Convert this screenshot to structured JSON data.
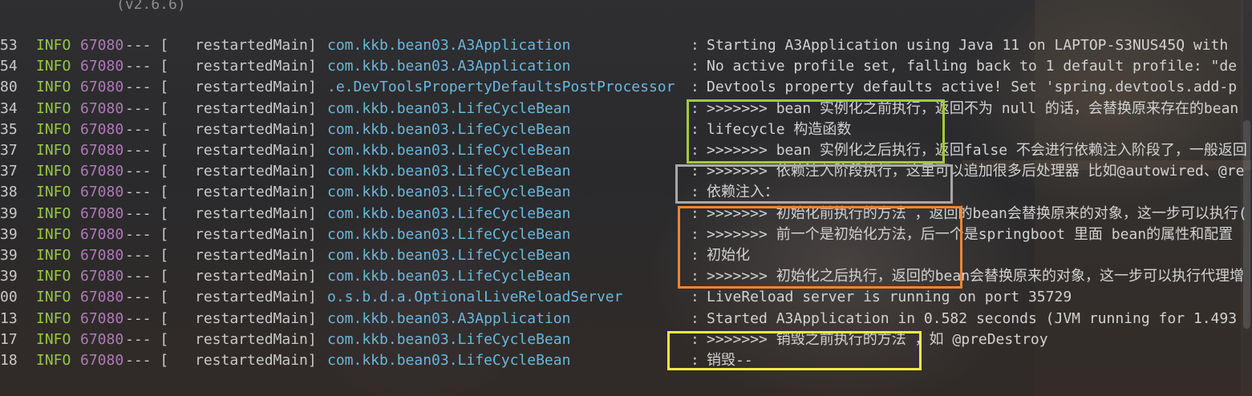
{
  "banner": "(v2.6.6)",
  "highlight_colors": {
    "green": "#a3c93a",
    "gray": "#a8a8a8",
    "orange": "#e8863a",
    "yellow": "#f1ee3a"
  },
  "log_lines": [
    {
      "ms": "53",
      "level": "INFO",
      "pid": "67080",
      "sep": "--- [",
      "thread": "restartedMain]",
      "logger": "com.kkb.bean03.A3Application",
      "colon": ":",
      "message": "Starting A3Application using Java 11 on LAPTOP-S3NUS45Q with"
    },
    {
      "ms": "54",
      "level": "INFO",
      "pid": "67080",
      "sep": "--- [",
      "thread": "restartedMain]",
      "logger": "com.kkb.bean03.A3Application",
      "colon": ":",
      "message": "No active profile set, falling back to 1 default profile: \"de"
    },
    {
      "ms": "80",
      "level": "INFO",
      "pid": "67080",
      "sep": "--- [",
      "thread": "restartedMain]",
      "logger": ".e.DevToolsPropertyDefaultsPostProcessor",
      "colon": ":",
      "message": "Devtools property defaults active! Set 'spring.devtools.add-p"
    },
    {
      "ms": "34",
      "level": "INFO",
      "pid": "67080",
      "sep": "--- [",
      "thread": "restartedMain]",
      "logger": "com.kkb.bean03.LifeCycleBean",
      "colon": ":",
      "message": ">>>>>>> bean 实例化之前执行，返回不为 null 的话，会替换原来存在的bean"
    },
    {
      "ms": "35",
      "level": "INFO",
      "pid": "67080",
      "sep": "--- [",
      "thread": "restartedMain]",
      "logger": "com.kkb.bean03.LifeCycleBean",
      "colon": ":",
      "message": "lifecycle 构造函数"
    },
    {
      "ms": "37",
      "level": "INFO",
      "pid": "67080",
      "sep": "--- [",
      "thread": "restartedMain]",
      "logger": "com.kkb.bean03.LifeCycleBean",
      "colon": ":",
      "message": ">>>>>>> bean 实例化之后执行，返回false 不会进行依赖注入阶段了，一般返回"
    },
    {
      "ms": "37",
      "level": "INFO",
      "pid": "67080",
      "sep": "--- [",
      "thread": "restartedMain]",
      "logger": "com.kkb.bean03.LifeCycleBean",
      "colon": ":",
      "message": ">>>>>>> 依赖注入阶段执行，这里可以追加很多后处理器 比如@autowired、@re"
    },
    {
      "ms": "38",
      "level": "INFO",
      "pid": "67080",
      "sep": "--- [",
      "thread": "restartedMain]",
      "logger": "com.kkb.bean03.LifeCycleBean",
      "colon": ":",
      "message": "依赖注入："
    },
    {
      "ms": "39",
      "level": "INFO",
      "pid": "67080",
      "sep": "--- [",
      "thread": "restartedMain]",
      "logger": "com.kkb.bean03.LifeCycleBean",
      "colon": ":",
      "message": ">>>>>>> 初始化前执行的方法 ，返回的bean会替换原来的对象，这一步可以执行("
    },
    {
      "ms": "39",
      "level": "INFO",
      "pid": "67080",
      "sep": "--- [",
      "thread": "restartedMain]",
      "logger": "com.kkb.bean03.LifeCycleBean",
      "colon": ":",
      "message": ">>>>>>> 前一个是初始化方法，后一个是springboot 里面 bean的属性和配置"
    },
    {
      "ms": "39",
      "level": "INFO",
      "pid": "67080",
      "sep": "--- [",
      "thread": "restartedMain]",
      "logger": "com.kkb.bean03.LifeCycleBean",
      "colon": ":",
      "message": "初始化"
    },
    {
      "ms": "39",
      "level": "INFO",
      "pid": "67080",
      "sep": "--- [",
      "thread": "restartedMain]",
      "logger": "com.kkb.bean03.LifeCycleBean",
      "colon": ":",
      "message": ">>>>>>> 初始化之后执行，返回的bean会替换原来的对象，这一步可以执行代理增"
    },
    {
      "ms": "00",
      "level": "INFO",
      "pid": "67080",
      "sep": "--- [",
      "thread": "restartedMain]",
      "logger": "o.s.b.d.a.OptionalLiveReloadServer",
      "colon": ":",
      "message": "LiveReload server is running on port 35729"
    },
    {
      "ms": "13",
      "level": "INFO",
      "pid": "67080",
      "sep": "--- [",
      "thread": "restartedMain]",
      "logger": "com.kkb.bean03.A3Application",
      "colon": ":",
      "message": "Started A3Application in 0.582 seconds (JVM running for 1.493"
    },
    {
      "ms": "17",
      "level": "INFO",
      "pid": "67080",
      "sep": "--- [",
      "thread": "restartedMain]",
      "logger": "com.kkb.bean03.LifeCycleBean",
      "colon": ":",
      "message": ">>>>>>> 销毁之前执行的方法 ，如 @preDestroy"
    },
    {
      "ms": "18",
      "level": "INFO",
      "pid": "67080",
      "sep": "--- [",
      "thread": "restartedMain]",
      "logger": "com.kkb.bean03.LifeCycleBean",
      "colon": ":",
      "message": "销毁--"
    }
  ]
}
